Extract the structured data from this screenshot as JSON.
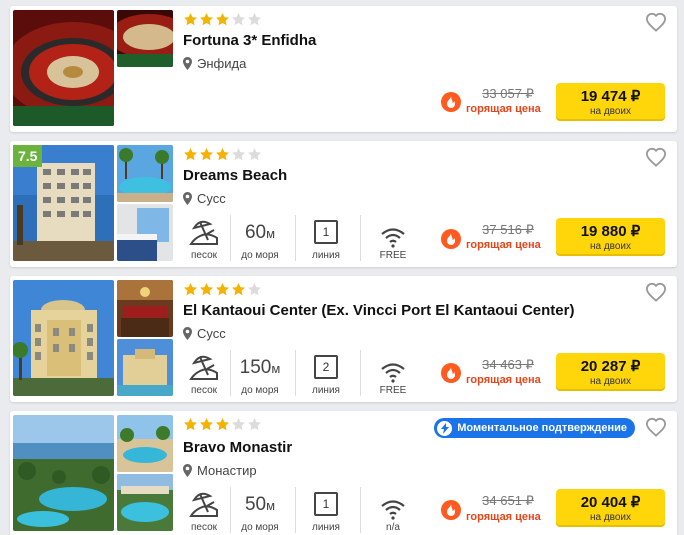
{
  "colors": {
    "star_on": "#f5b300",
    "star_off": "#dcdcdc",
    "hot": "#e8451a",
    "button": "#ffd60a",
    "rating": "#6cb33e",
    "instant": "#1a73e8"
  },
  "hotels": [
    {
      "stars": 3,
      "name": "Fortuna 3* Enfidha",
      "location": "Энфида",
      "old_price": "33 057 ₽",
      "hot_label": "горящая цена",
      "price": "19 474 ₽",
      "price_note": "на двоих"
    },
    {
      "rating": "7.5",
      "stars": 3,
      "name": "Dreams Beach",
      "location": "Сусс",
      "amenities": {
        "beach": "песок",
        "distance_value": "60",
        "distance_unit": "м",
        "distance_label": "до моря",
        "line_value": "1",
        "line_label": "линия",
        "wifi_label": "FREE"
      },
      "old_price": "37 516 ₽",
      "hot_label": "горящая цена",
      "price": "19 880 ₽",
      "price_note": "на двоих"
    },
    {
      "stars": 4,
      "name": "El Kantaoui Center (Ex. Vincci Port El Kantaoui Center)",
      "location": "Сусс",
      "amenities": {
        "beach": "песок",
        "distance_value": "150",
        "distance_unit": "м",
        "distance_label": "до моря",
        "line_value": "2",
        "line_label": "линия",
        "wifi_label": "FREE"
      },
      "old_price": "34 463 ₽",
      "hot_label": "горящая цена",
      "price": "20 287 ₽",
      "price_note": "на двоих"
    },
    {
      "stars": 3,
      "name": "Bravo Monastir",
      "location": "Монастир",
      "instant_label": "Моментальное подтверждение",
      "amenities": {
        "beach": "песок",
        "distance_value": "50",
        "distance_unit": "м",
        "distance_label": "до моря",
        "line_value": "1",
        "line_label": "линия",
        "wifi_label": "n/a"
      },
      "old_price": "34 651 ₽",
      "hot_label": "горящая цена",
      "price": "20 404 ₽",
      "price_note": "на двоих"
    }
  ]
}
